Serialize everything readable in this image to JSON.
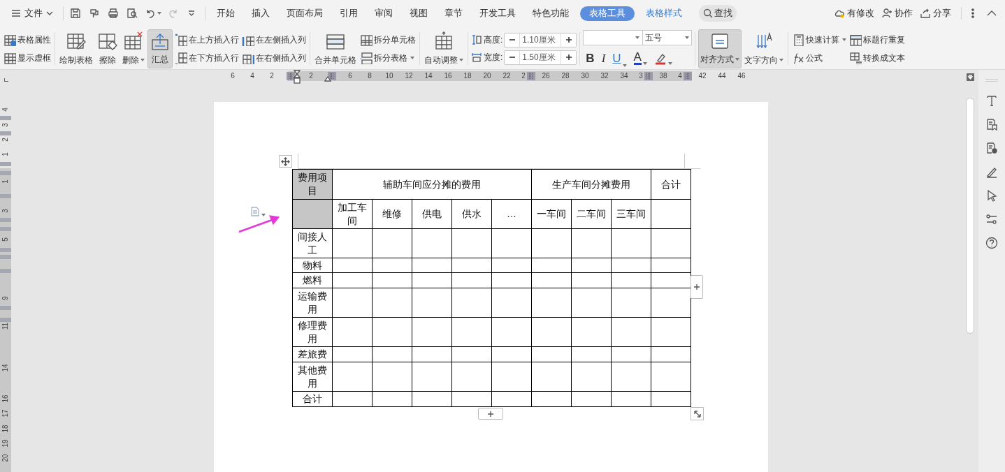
{
  "menu_bar": {
    "file_menu": "文件",
    "tabs": [
      {
        "label": "开始",
        "selected": false
      },
      {
        "label": "插入",
        "selected": false
      },
      {
        "label": "页面布局",
        "selected": false
      },
      {
        "label": "引用",
        "selected": false
      },
      {
        "label": "审阅",
        "selected": false
      },
      {
        "label": "视图",
        "selected": false
      },
      {
        "label": "章节",
        "selected": false
      },
      {
        "label": "开发工具",
        "selected": false
      },
      {
        "label": "特色功能",
        "selected": false
      },
      {
        "label": "表格工具",
        "selected": true
      },
      {
        "label": "表格样式",
        "selected": false
      }
    ],
    "search": "查找",
    "actions": [
      "有修改",
      "协作",
      "分享"
    ]
  },
  "ribbon": {
    "groups": [
      {
        "items": [
          {
            "kind": "small",
            "label": "表格属性",
            "dropdown": false
          },
          {
            "kind": "small",
            "label": "显示虚框",
            "dropdown": false
          }
        ]
      },
      {
        "items": [
          {
            "kind": "large",
            "label": "绘制表格",
            "dropdown": false,
            "selected": false
          },
          {
            "kind": "large",
            "label": "擦除",
            "dropdown": false,
            "selected": false
          },
          {
            "kind": "large",
            "label": "删除",
            "dropdown": true,
            "selected": false
          },
          {
            "kind": "large",
            "label": "汇总",
            "dropdown": false,
            "selected": true
          },
          {
            "kind": "small",
            "label": "在上方插入行",
            "dropdown": false
          },
          {
            "kind": "small",
            "label": "在下方插入行",
            "dropdown": false
          },
          {
            "kind": "small",
            "label": "在左侧插入列",
            "dropdown": false
          },
          {
            "kind": "small",
            "label": "在右侧插入列",
            "dropdown": false
          }
        ]
      },
      {
        "items": [
          {
            "kind": "large",
            "label": "合并单元格",
            "dropdown": false,
            "selected": false
          },
          {
            "kind": "small",
            "label": "拆分单元格",
            "dropdown": false
          },
          {
            "kind": "small",
            "label": "拆分表格",
            "dropdown": true
          }
        ]
      },
      {
        "items": [
          {
            "kind": "large",
            "label": "自动调整",
            "dropdown": true,
            "selected": false
          }
        ]
      },
      {
        "items": [
          {
            "kind": "spinner",
            "label": "高度:",
            "value": "1.10厘米"
          },
          {
            "kind": "spinner",
            "label": "宽度:",
            "value": "1.50厘米"
          }
        ]
      },
      {
        "items": [
          {
            "kind": "font",
            "size": "五号",
            "format_buttons": [
              "B",
              "I",
              "U",
              "A"
            ]
          }
        ]
      },
      {
        "items": [
          {
            "kind": "large",
            "label": "对齐方式",
            "dropdown": true,
            "selected": true
          },
          {
            "kind": "large",
            "label": "文字方向",
            "dropdown": true,
            "selected": false
          }
        ]
      },
      {
        "items": [
          {
            "kind": "small",
            "label": "快速计算",
            "dropdown": true
          },
          {
            "kind": "small",
            "label": "公式",
            "dropdown": false
          },
          {
            "kind": "small",
            "label": "标题行重复",
            "dropdown": false
          },
          {
            "kind": "small",
            "label": "转换成文本",
            "dropdown": false
          }
        ]
      }
    ]
  },
  "horizontal_ruler": [
    "6",
    "4",
    "2",
    "2",
    "6",
    "8",
    "10",
    "12",
    "14",
    "16",
    "18",
    "20",
    "22",
    "2",
    "26",
    "28",
    "30",
    "32",
    "34",
    "3",
    "38",
    "4",
    "42",
    "44",
    "46"
  ],
  "vertical_ruler": [
    "4",
    "3",
    "2",
    "1",
    "1",
    "3",
    "5",
    "9",
    "11",
    "14",
    "16",
    "17",
    "18",
    "19",
    "20"
  ],
  "table": {
    "header": [
      {
        "text": "费用项目",
        "selected": true
      },
      {
        "text": "辅助车间应分摊的费用",
        "selected": false,
        "children": [
          "加工车间",
          "维修",
          "供电",
          "供水",
          "…"
        ]
      },
      {
        "text": "生产车间分摊费用",
        "selected": false,
        "children": [
          "一车间",
          "二车间",
          "三车间"
        ]
      },
      {
        "text": "合计",
        "selected": false
      }
    ],
    "rows": [
      {
        "label": "间接人工"
      },
      {
        "label": "物料"
      },
      {
        "label": "燃料"
      },
      {
        "label": "运输费用"
      },
      {
        "label": "修理费用"
      },
      {
        "label": "差旅费"
      },
      {
        "label": "其他费用"
      },
      {
        "label": "合计"
      }
    ]
  }
}
